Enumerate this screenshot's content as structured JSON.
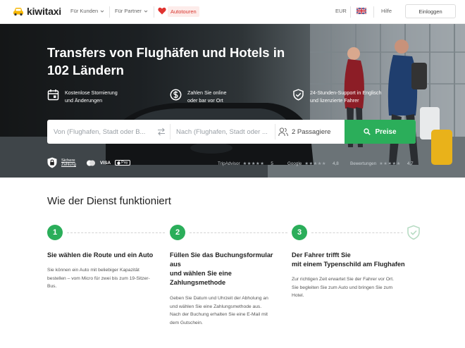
{
  "header": {
    "logo_text": "kiwitaxi",
    "nav": [
      {
        "label": "Für Kunden",
        "icon": "chevron-down-icon"
      },
      {
        "label": "Für Partner",
        "icon": "chevron-down-icon"
      }
    ],
    "autotouren": "Autotouren",
    "currency": "EUR",
    "language_flag": "uk-flag-icon",
    "help": "Hilfe",
    "login": "Einloggen"
  },
  "hero": {
    "title": "Transfers von Flughäfen und Hotels in 102 Ländern",
    "features": [
      {
        "icon": "calendar-icon",
        "line1": "Kostenlose Stornierung",
        "line2": "und Änderungen"
      },
      {
        "icon": "dollar-icon",
        "line1": "Zahlen Sie online",
        "line2": "oder bar vor Ort"
      },
      {
        "icon": "shield-check-icon",
        "line1": "24-Stunden-Support in Englisch",
        "line2": "und lizenzierte Fahrer"
      }
    ],
    "search": {
      "from_placeholder": "Von (Flughafen, Stadt oder B...",
      "to_placeholder": "Nach (Flughafen, Stadt oder ...",
      "passengers": "2 Passagiere",
      "submit": "Preise"
    },
    "secure_payment": {
      "line1": "Sichere",
      "line2": "Zahlung"
    },
    "payment_methods": [
      "mastercard-icon",
      "VISA",
      "apple-pay-icon"
    ],
    "apple_pay_label": "Pay",
    "ratings": [
      {
        "source": "TripAdvisor",
        "stars": "★★★★★",
        "score": "5"
      },
      {
        "source": "Google",
        "stars": "★★★★★",
        "score": "4,8"
      },
      {
        "source": "Bewertungen",
        "stars": "★★★★★",
        "score": "4,7"
      }
    ]
  },
  "how": {
    "title": "Wie der Dienst funktioniert",
    "steps": [
      {
        "number": "1",
        "title_lines": [
          "Sie wählen die Route und ein Auto"
        ],
        "desc_lines": [
          "Sie können ein Auto mit beliebiger Kapazität",
          "bestellen – vom Micro für zwei bis zum 19-Sitzer-",
          "Bus."
        ]
      },
      {
        "number": "2",
        "title_lines": [
          "Füllen Sie das Buchungsformular",
          "aus",
          "und wählen Sie eine",
          "Zahlungsmethode"
        ],
        "desc_lines": [
          "Geben Sie Datum und Uhrzeit der Abholung an",
          "und wählen Sie eine Zahlungsmethode aus.",
          "Nach der Buchung erhalten Sie eine E-Mail mit",
          "dem Gutschein."
        ]
      },
      {
        "number": "3",
        "title_lines": [
          "Der Fahrer trifft Sie",
          "mit einem Typenschild am Flughafen"
        ],
        "desc_lines": [
          "Zur richtigen Zeit erwartet Sie der Fahrer vor Ort.",
          "Sie begleiten Sie zum Auto und bringen Sie zum",
          "Hotel."
        ]
      }
    ],
    "end_icon": "shield-check-icon"
  },
  "colors": {
    "accent_green": "#2bae5a",
    "brand_yellow": "#f6b600",
    "autotouren_red": "#d8362f"
  }
}
